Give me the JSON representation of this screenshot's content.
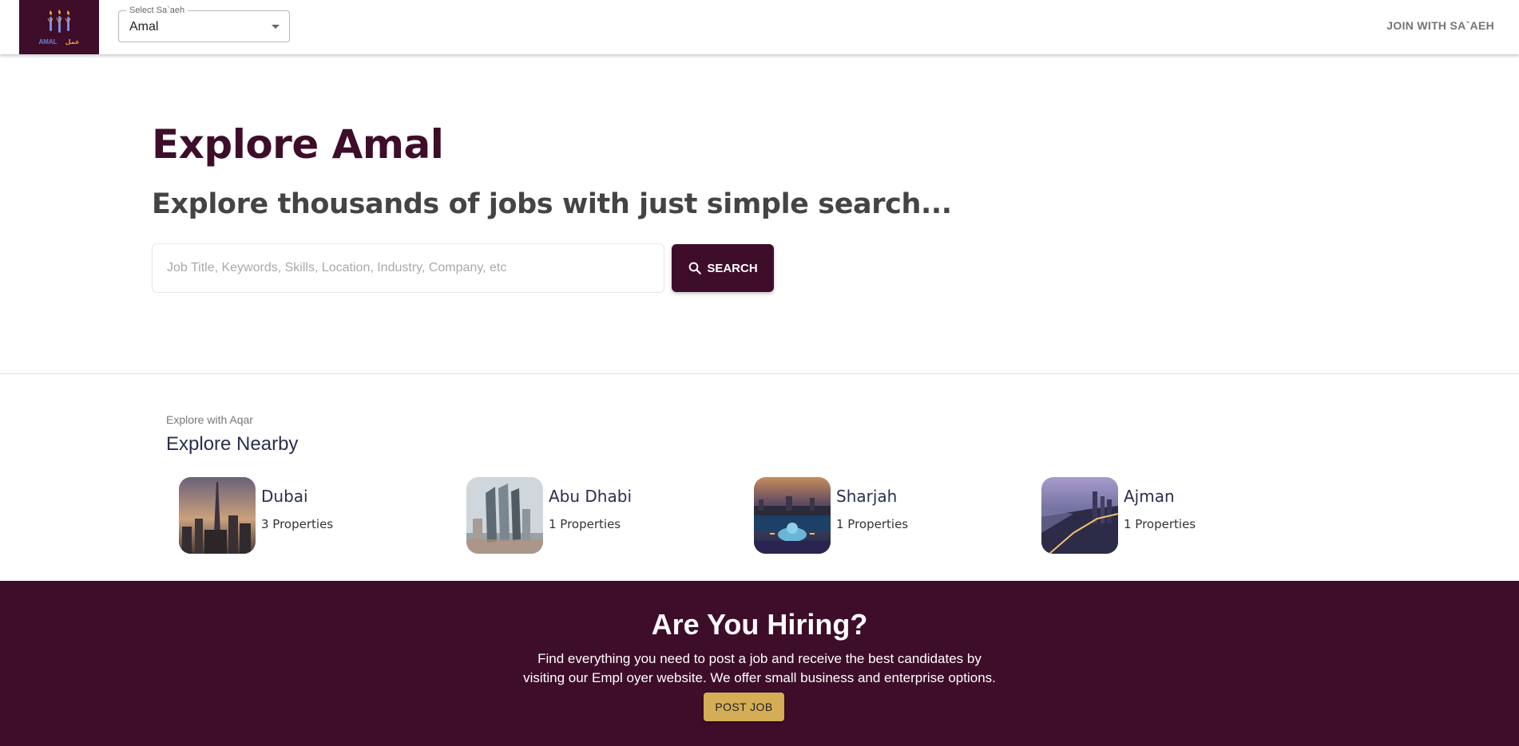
{
  "header": {
    "logo": {
      "text_latin": "AMAL",
      "text_arabic": "عمل"
    },
    "select": {
      "label": "Select Sa`aeh",
      "value": "Amal"
    },
    "join_label": "JOIN WITH SA`AEH"
  },
  "hero": {
    "title": "Explore Amal",
    "subtitle": "Explore thousands of jobs with just simple search...",
    "search": {
      "placeholder": "Job Title, Keywords, Skills, Location, Industry, Company, etc",
      "value": "",
      "button_label": "SEARCH"
    }
  },
  "nearby": {
    "overline": "Explore with Aqar",
    "title": "Explore Nearby",
    "cities": [
      {
        "name": "Dubai",
        "count": "3 Properties"
      },
      {
        "name": "Abu Dhabi",
        "count": "1 Properties"
      },
      {
        "name": "Sharjah",
        "count": "1 Properties"
      },
      {
        "name": "Ajman",
        "count": "1 Properties"
      }
    ]
  },
  "hiring": {
    "title": "Are You Hiring?",
    "line1": "Find everything you need to post a job and receive the best candidates by",
    "line2": "visiting our Empl oyer website. We offer small business and enterprise options.",
    "button_label": "POST JOB"
  },
  "colors": {
    "primary": "#3e0d2a",
    "accent": "#d4ad56",
    "heading": "#2a2f4e"
  }
}
